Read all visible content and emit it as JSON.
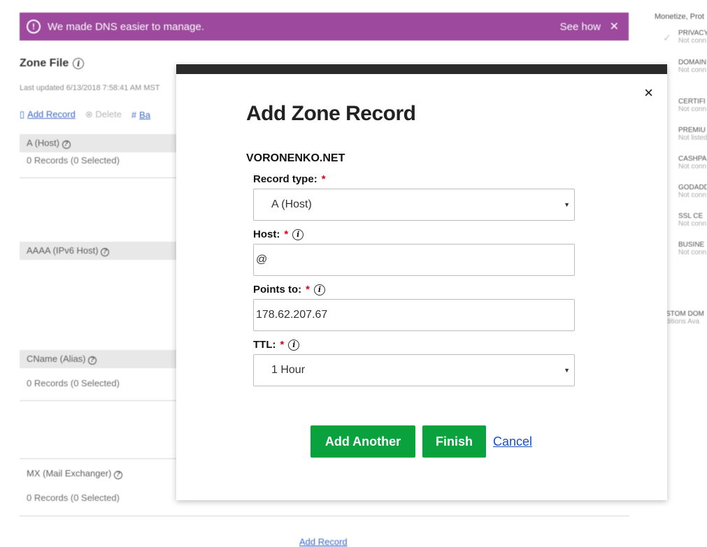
{
  "background": {
    "banner": {
      "message": "We made DNS easier to manage.",
      "see_how": "See how",
      "close": "✕"
    },
    "zone_file": {
      "title": "Zone File",
      "last_updated": "Last updated 6/13/2018 7:58:41 AM MST",
      "toolbar": {
        "add_record": "Add Record",
        "delete": "Delete",
        "bulk": "Ba"
      },
      "sections": [
        {
          "name": "A (Host)",
          "count": "0 Records (0 Selected)"
        },
        {
          "name": "AAAA (IPv6 Host)",
          "count": ""
        },
        {
          "name": "CName (Alias)",
          "count": "0 Records (0 Selected)"
        },
        {
          "name": "MX (Mail Exchanger)",
          "count": "0 Records (0 Selected)"
        }
      ],
      "bottom_link": "Add Record"
    },
    "sidebar": {
      "top_label": "Monetize, Prot",
      "items": [
        {
          "name": "PRIVACY",
          "sub": "Not conn"
        },
        {
          "name": "DOMAIN",
          "sub": "Not conn"
        },
        {
          "name": "CERTIFI",
          "sub": "Not conn"
        },
        {
          "name": "PREMIU",
          "sub": "Not listed"
        },
        {
          "name": "CASHPA",
          "sub": "Not conn"
        },
        {
          "name": "GODADD",
          "sub": "Not conn"
        },
        {
          "name": "SSL CE",
          "sub": "Not conn"
        },
        {
          "name": "BUSINE",
          "sub": "Not conn"
        }
      ],
      "custom_name": "STOM DOM",
      "custom_sub": "ditions Ava"
    }
  },
  "modal": {
    "title": "Add Zone Record",
    "domain": "VORONENKO.NET",
    "close": "×",
    "record_type": {
      "label": "Record type:",
      "value": "A (Host)"
    },
    "host": {
      "label": "Host:",
      "value": "@"
    },
    "points_to": {
      "label": "Points to:",
      "value": "178.62.207.67"
    },
    "ttl": {
      "label": "TTL:",
      "value": "1 Hour"
    },
    "required_marker": "*",
    "buttons": {
      "add_another": "Add Another",
      "finish": "Finish",
      "cancel": "Cancel"
    }
  },
  "colors": {
    "banner": "#8c2a8c",
    "primary_button": "#09a23f",
    "link": "#1d4fbf",
    "required": "#d6001c",
    "modal_top_bar": "#2b2b2b"
  }
}
